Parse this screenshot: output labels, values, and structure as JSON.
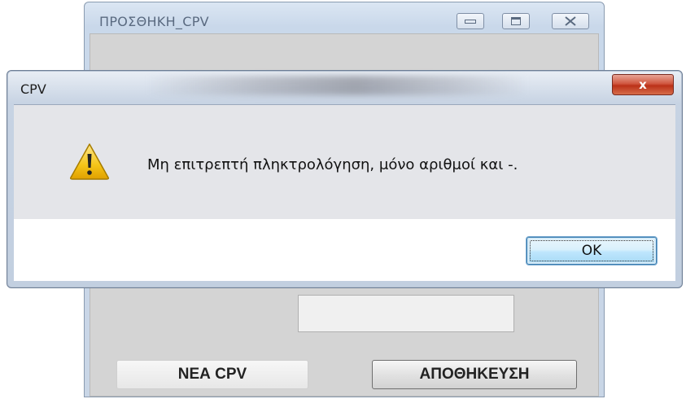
{
  "parent_window": {
    "title": "ΠΡΟΣΘΗΚΗ_CPV",
    "controls": {
      "minimize_icon": "minimize-icon",
      "maximize_icon": "maximize-icon",
      "close_icon": "close-icon"
    },
    "buttons": {
      "new_label": "ΝΕΑ CPV",
      "save_label": "ΑΠΟΘΗΚΕΥΣΗ"
    }
  },
  "dialog": {
    "title": "CPV",
    "close_glyph": "x",
    "icon": "warning-icon",
    "message": "Μη επιτρεπτή πληκτρολόγηση, μόνο αριθμοί και -.",
    "ok_label": "OK"
  },
  "colors": {
    "warning_fill": "#f5c518",
    "close_button": "#c4391b",
    "ok_accent": "#3c7fb1"
  }
}
